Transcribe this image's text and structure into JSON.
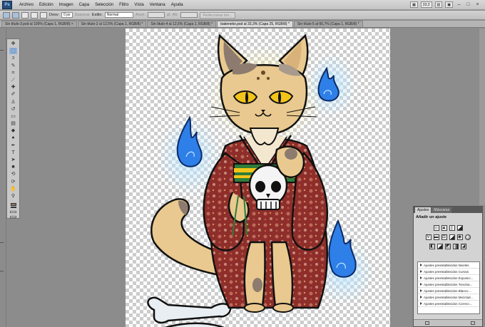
{
  "menubar": {
    "logo": "Ps",
    "items": [
      "Archivo",
      "Edición",
      "Imagen",
      "Capa",
      "Selección",
      "Filtro",
      "Vista",
      "Ventana",
      "Ayuda"
    ],
    "zoom": "33,3"
  },
  "options": {
    "feather_label": "Desv:",
    "feather_value": "0 px",
    "antialias": "Suavizar",
    "style_label": "Estilo:",
    "style_value": "Normal",
    "width_label": "Anch:",
    "height_label": "Alt:",
    "refine_button": "Perfeccionar bor..."
  },
  "tabs": [
    {
      "label": "Sin título-3.psd al 100% (Capa 1, RGB/8) ×",
      "active": false
    },
    {
      "label": "Sin título-2 al 12,5% (Capa 1, RGB/8) *",
      "active": false
    },
    {
      "label": "Sin título-4 al 12,5% (Capa 1, RGB/8) *",
      "active": false
    },
    {
      "label": "bakeneko.psd al 33,3% (Capa 25, RGB/8) *",
      "active": true
    },
    {
      "label": "Sin título-5 al 66,7% (Capa 1, RGB/8) *",
      "active": false
    }
  ],
  "toolbox": {
    "tools": [
      "move-tool",
      "marquee-tool",
      "lasso-tool",
      "quick-select-tool",
      "crop-tool",
      "eyedropper-tool",
      "healing-tool",
      "brush-tool",
      "clone-stamp-tool",
      "history-brush-tool",
      "eraser-tool",
      "gradient-tool",
      "blur-tool",
      "dodge-tool",
      "pen-tool",
      "type-tool",
      "path-select-tool",
      "shape-tool",
      "3d-tool",
      "3d-camera-tool",
      "hand-tool",
      "zoom-tool"
    ],
    "foreground_color": "#8a7560",
    "background_color": "#ffffff"
  },
  "adjust_panel": {
    "tabs": [
      "Ajustes",
      "Máscaras"
    ],
    "title": "Añadir un ajuste",
    "presets": [
      "Ajustes preestablecidos Niveles",
      "Ajustes preestablecidos Curvas",
      "Ajustes preestablecidos Exposici...",
      "Ajustes preestablecidos Tono/sa...",
      "Ajustes preestablecidos Blanco ...",
      "Ajustes preestablecidos Mezclad...",
      "Ajustes preestablecidos Correcc..."
    ]
  },
  "colors": {
    "flame_blue": "#2f7fe8",
    "kimono_red": "#8e2e2a",
    "cat_fur": "#e9c98f",
    "eye_yellow": "#f3c419"
  }
}
